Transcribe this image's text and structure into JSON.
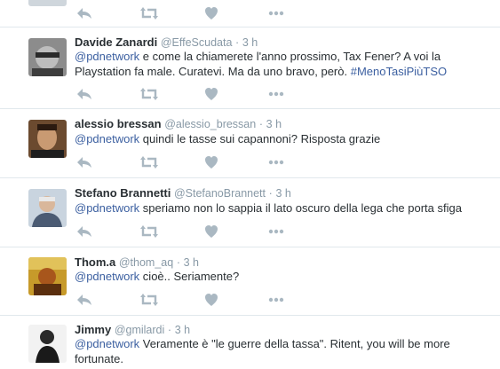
{
  "timeline": {
    "top_actions": {
      "reply": "reply-icon",
      "retweet": "retweet-icon",
      "like": "heart-icon",
      "more": "more-icon"
    },
    "tweets": [
      {
        "name": "Davide Zanardi",
        "handle": "@EffeScudata",
        "separator": "·",
        "time": "3 h",
        "mention": "@pdnetwork",
        "text": " e come la chiamerete l'anno prossimo, Tax Fener? A voi la Playstation fa male. Curatevi. Ma da uno bravo, però. ",
        "hashtag": "#MenoTasiPiùTSO"
      },
      {
        "name": "alessio bressan",
        "handle": "@alessio_bressan",
        "separator": "·",
        "time": "3 h",
        "mention": "@pdnetwork",
        "text": " quindi le tasse sui capannoni? Risposta grazie"
      },
      {
        "name": "Stefano Brannetti",
        "handle": "@StefanoBrannett",
        "separator": "·",
        "time": "3 h",
        "mention": "@pdnetwork",
        "text": " speriamo non lo sappia il lato oscuro della lega che porta sfiga"
      },
      {
        "name": "Thom.a",
        "handle": "@thom_aq",
        "separator": "·",
        "time": "3 h",
        "mention": "@pdnetwork",
        "text": " cioè.. Seriamente?"
      },
      {
        "name": "Jimmy",
        "handle": "@gmilardi",
        "separator": "·",
        "time": "3 h",
        "mention": "@pdnetwork",
        "text": " Veramente è \"le guerre della tassa\". Ritent, you will be more fortunate."
      }
    ]
  },
  "colors": {
    "link": "#3b5fa0",
    "muted": "#8899a6",
    "icon": "#aab8c2",
    "border": "#e1e8ed"
  }
}
